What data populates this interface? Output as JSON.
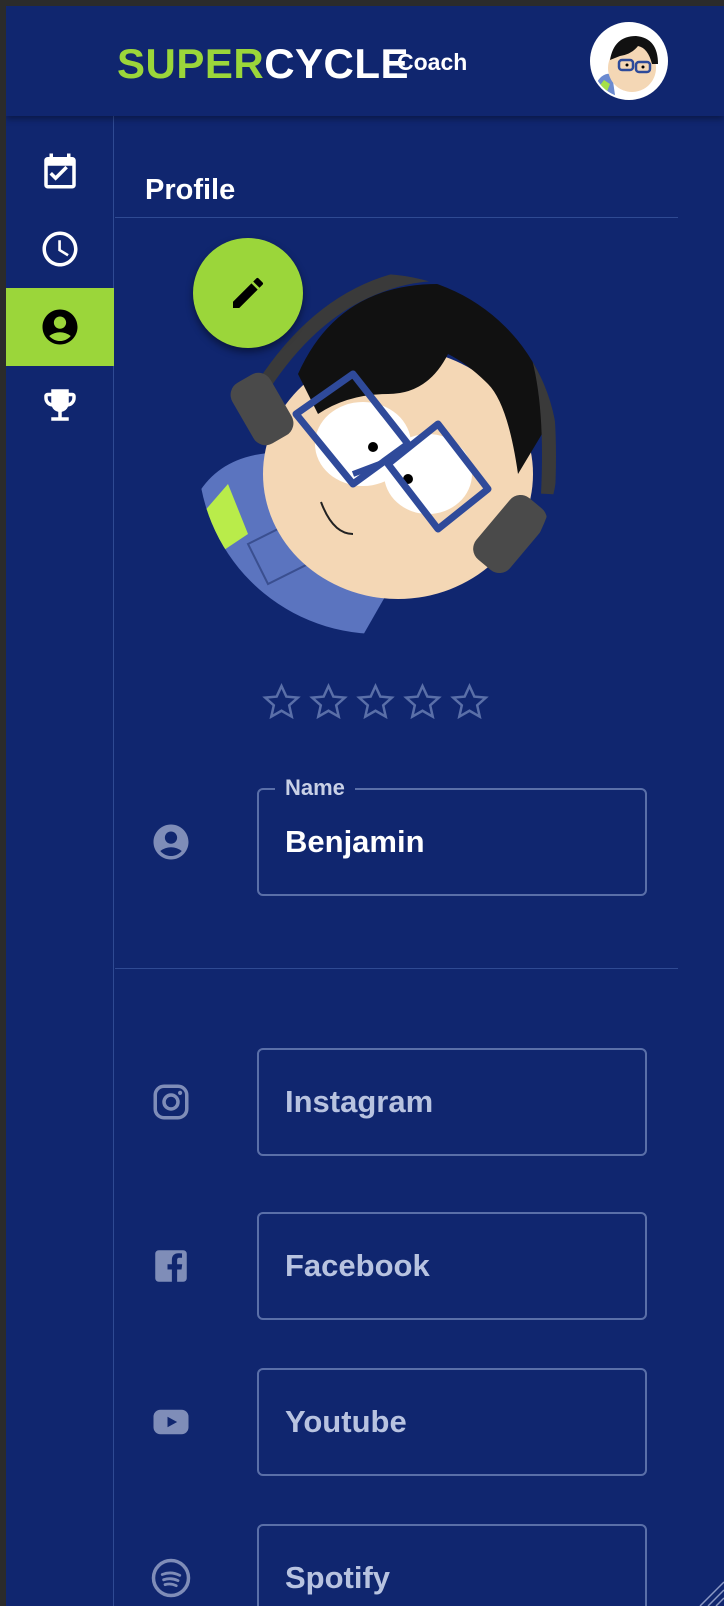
{
  "header": {
    "brand_part1": "SUPER",
    "brand_part2": "CYCLE",
    "brand_suffix": "Coach",
    "avatar_icon": "user-avatar"
  },
  "sidebar": {
    "items": [
      {
        "icon": "calendar-check-icon",
        "active": false
      },
      {
        "icon": "clock-icon",
        "active": false
      },
      {
        "icon": "account-circle-icon",
        "active": true
      },
      {
        "icon": "trophy-icon",
        "active": false
      }
    ]
  },
  "main": {
    "title": "Profile",
    "edit_icon": "pencil-icon",
    "rating": {
      "value": 0,
      "max": 5
    },
    "name_field": {
      "label": "Name",
      "value": "Benjamin"
    },
    "social": {
      "instagram": {
        "placeholder": "Instagram"
      },
      "facebook": {
        "placeholder": "Facebook"
      },
      "youtube": {
        "placeholder": "Youtube"
      },
      "spotify": {
        "placeholder": "Spotify"
      }
    }
  },
  "colors": {
    "background": "#10266f",
    "accent": "#9bd63a",
    "text": "#ffffff",
    "muted": "#7f8db8"
  }
}
